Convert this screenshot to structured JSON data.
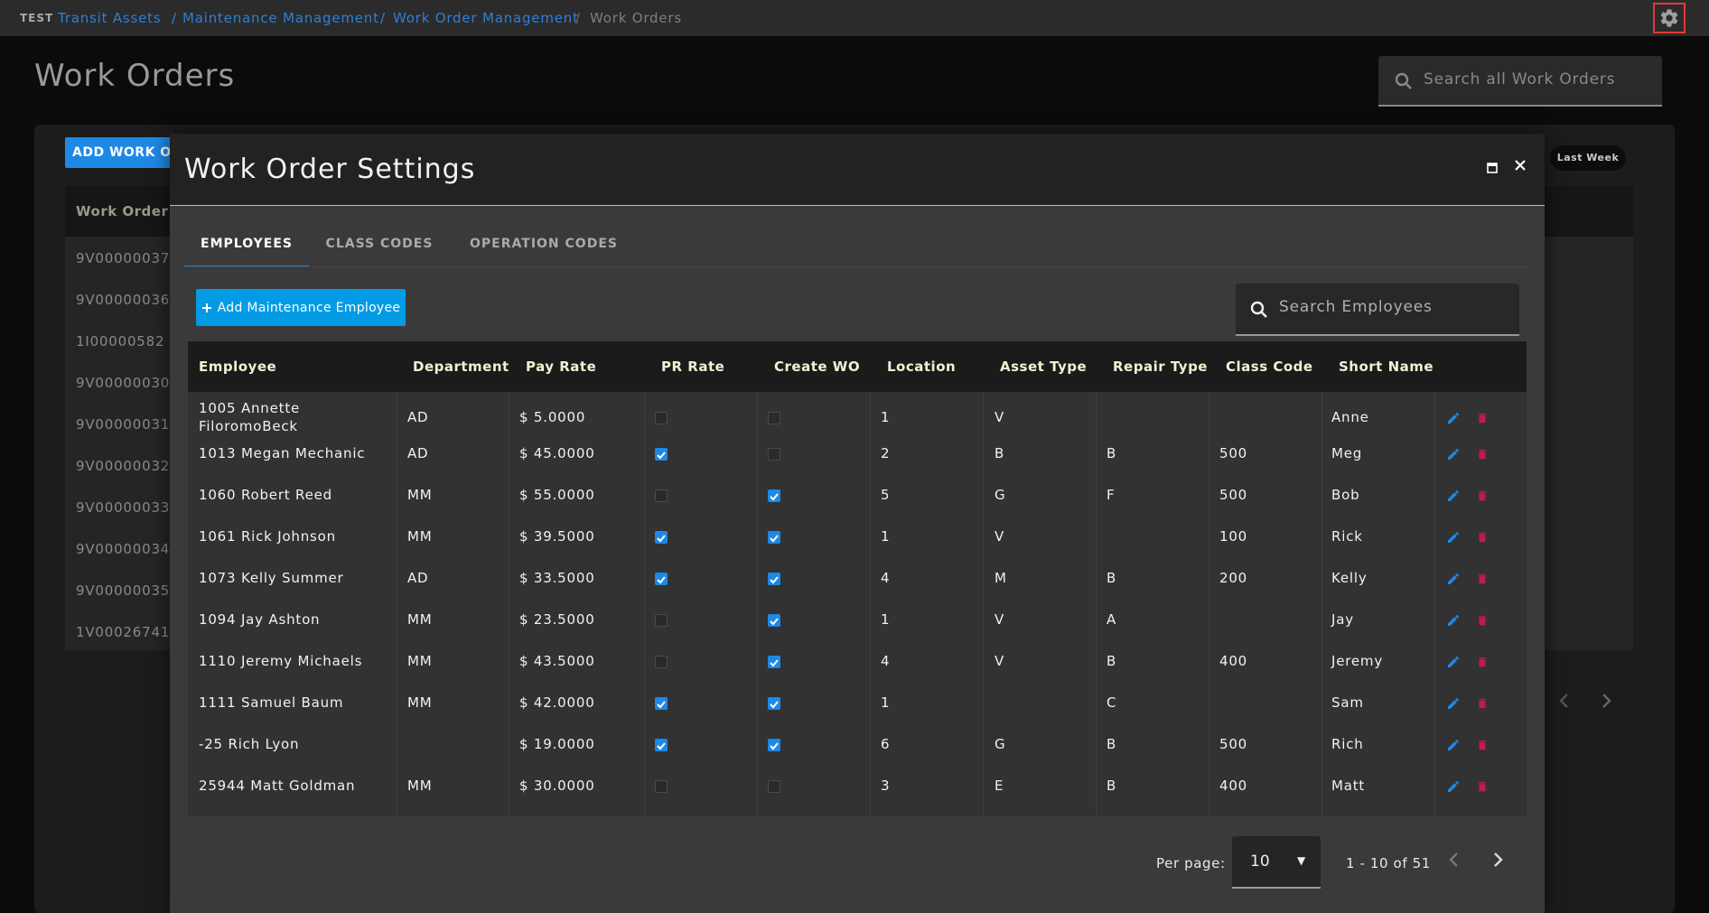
{
  "topbar": {
    "env": "TEST",
    "breadcrumb": [
      "Transit Assets",
      "Maintenance Management",
      "Work Order Management"
    ],
    "current": "Work Orders"
  },
  "page": {
    "title": "Work Orders",
    "search_placeholder": "Search all Work Orders",
    "add_button": "ADD WORK ORDER",
    "last_week": "Last Week",
    "table_header": "Work Order #",
    "work_orders": [
      "9V00000037",
      "9V00000036",
      "1I00000582",
      "9V00000030",
      "9V00000031",
      "9V00000032",
      "9V00000033",
      "9V00000034",
      "9V00000035",
      "1V00026741"
    ]
  },
  "modal": {
    "title": "Work Order Settings",
    "tabs": [
      "EMPLOYEES",
      "CLASS CODES",
      "OPERATION CODES"
    ],
    "active_tab": 0,
    "add_button": "Add Maintenance Employee",
    "search_placeholder": "Search Employees",
    "columns": [
      "Employee",
      "Department",
      "Pay Rate",
      "PR Rate",
      "Create WO",
      "Location",
      "Asset Type",
      "Repair Type",
      "Class Code",
      "Short Name"
    ],
    "rows": [
      {
        "employee": "1005 Annette FiloromoBeck",
        "department": "AD",
        "pay_rate": "$ 5.0000",
        "pr_rate": false,
        "create_wo": false,
        "location": "1",
        "asset_type": "V",
        "repair_type": "",
        "class_code": "",
        "short_name": "Anne"
      },
      {
        "employee": "1013 Megan Mechanic",
        "department": "AD",
        "pay_rate": "$ 45.0000",
        "pr_rate": true,
        "create_wo": false,
        "location": "2",
        "asset_type": "B",
        "repair_type": "B",
        "class_code": "500",
        "short_name": "Meg"
      },
      {
        "employee": "1060 Robert Reed",
        "department": "MM",
        "pay_rate": "$ 55.0000",
        "pr_rate": false,
        "create_wo": true,
        "location": "5",
        "asset_type": "G",
        "repair_type": "F",
        "class_code": "500",
        "short_name": "Bob"
      },
      {
        "employee": "1061 Rick Johnson",
        "department": "MM",
        "pay_rate": "$ 39.5000",
        "pr_rate": true,
        "create_wo": true,
        "location": "1",
        "asset_type": "V",
        "repair_type": "",
        "class_code": "100",
        "short_name": "Rick"
      },
      {
        "employee": "1073 Kelly Summer",
        "department": "AD",
        "pay_rate": "$ 33.5000",
        "pr_rate": true,
        "create_wo": true,
        "location": "4",
        "asset_type": "M",
        "repair_type": "B",
        "class_code": "200",
        "short_name": "Kelly"
      },
      {
        "employee": "1094 Jay Ashton",
        "department": "MM",
        "pay_rate": "$ 23.5000",
        "pr_rate": false,
        "create_wo": true,
        "location": "1",
        "asset_type": "V",
        "repair_type": "A",
        "class_code": "",
        "short_name": "Jay"
      },
      {
        "employee": "1110 Jeremy Michaels",
        "department": "MM",
        "pay_rate": "$ 43.5000",
        "pr_rate": false,
        "create_wo": true,
        "location": "4",
        "asset_type": "V",
        "repair_type": "B",
        "class_code": "400",
        "short_name": "Jeremy"
      },
      {
        "employee": "1111 Samuel Baum",
        "department": "MM",
        "pay_rate": "$ 42.0000",
        "pr_rate": true,
        "create_wo": true,
        "location": "1",
        "asset_type": "",
        "repair_type": "C",
        "class_code": "",
        "short_name": "Sam"
      },
      {
        "employee": "-25 Rich Lyon",
        "department": "",
        "pay_rate": "$ 19.0000",
        "pr_rate": true,
        "create_wo": true,
        "location": "6",
        "asset_type": "G",
        "repair_type": "B",
        "class_code": "500",
        "short_name": "Rich"
      },
      {
        "employee": "25944 Matt Goldman",
        "department": "MM",
        "pay_rate": "$ 30.0000",
        "pr_rate": false,
        "create_wo": false,
        "location": "3",
        "asset_type": "E",
        "repair_type": "B",
        "class_code": "400",
        "short_name": "Matt"
      }
    ],
    "pagination": {
      "per_page_label": "Per page:",
      "per_page": "10",
      "range": "1 - 10 of 51"
    }
  },
  "colors": {
    "accent": "#1e88e5",
    "button": "#039be5",
    "delete": "#c2185b",
    "header_text": "#f4f0d4"
  },
  "icons": [
    "gear-icon",
    "search-icon",
    "maximize-icon",
    "close-icon",
    "plus-icon",
    "edit-icon",
    "delete-icon",
    "chevron-left-icon",
    "chevron-right-icon",
    "dropdown-arrow-icon"
  ]
}
